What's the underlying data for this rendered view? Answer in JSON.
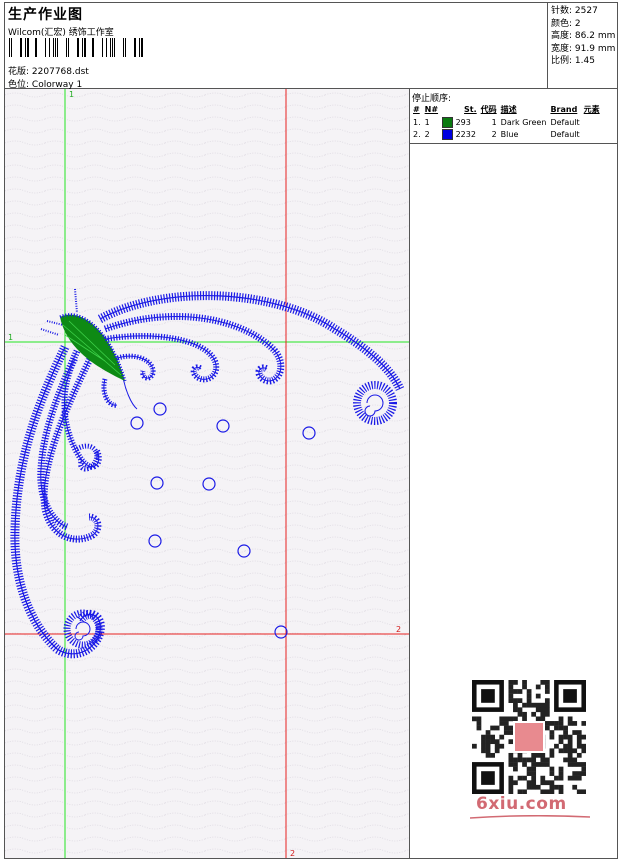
{
  "header": {
    "title": "生产作业图",
    "studio": "Wilcom(汇宏) 绣饰工作室",
    "design_label": "花版:",
    "design_value": "2207768.dst",
    "colorway_label": "色位:",
    "colorway_value": "Colorway 1"
  },
  "stats": [
    {
      "label": "针数:",
      "value": "2527"
    },
    {
      "label": "颜色:",
      "value": "2"
    },
    {
      "label": "高度:",
      "value": "86.2 mm"
    },
    {
      "label": "宽度:",
      "value": "91.9 mm"
    },
    {
      "label": "比例:",
      "value": "1.45"
    }
  ],
  "stop_sequence": {
    "title": "停止顺序:",
    "columns": [
      "#",
      "N#",
      "St.",
      "代码",
      "描述",
      "Brand",
      "元素"
    ],
    "rows": [
      {
        "index": "1.",
        "n": "1",
        "stitches": "293",
        "code": "1",
        "description": "Dark Green",
        "brand": "Default",
        "color": "#0a7a10"
      },
      {
        "index": "2.",
        "n": "2",
        "stitches": "2232",
        "code": "2",
        "description": "Blue",
        "brand": "Default",
        "color": "#0000e0"
      }
    ]
  },
  "markers": {
    "green_label": "1",
    "red_label": "2"
  },
  "watermark": {
    "text": "6xiu.com"
  },
  "colors": {
    "guide_green": "#22e622",
    "guide_red": "#e82020",
    "thread_blue": "#1a1ae6",
    "thread_green": "#0e8a14"
  }
}
